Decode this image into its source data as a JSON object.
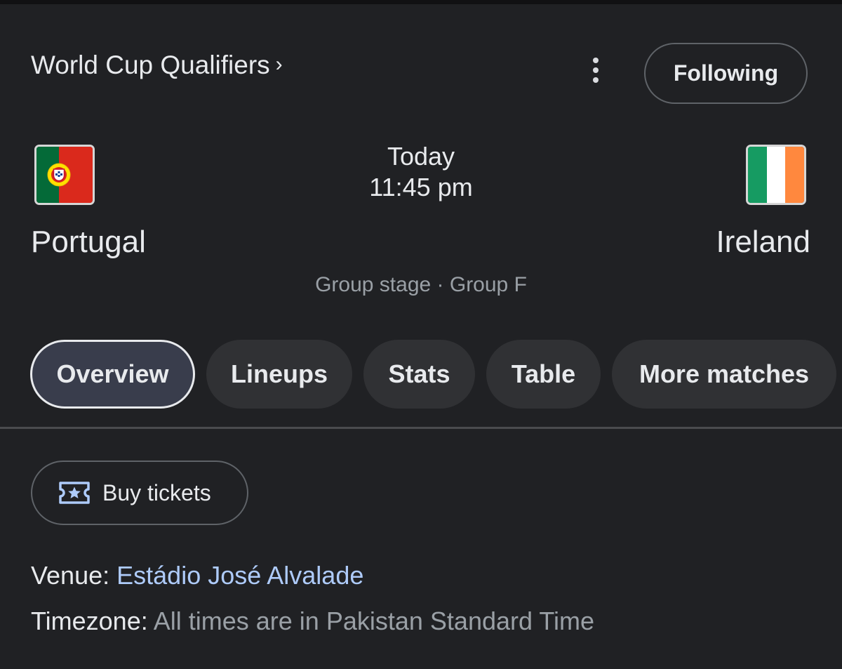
{
  "header": {
    "competition": "World Cup Qualifiers",
    "competition_chevron": "›",
    "menu_icon": "more-vert-icon",
    "follow_label": "Following"
  },
  "match": {
    "home": {
      "name": "Portugal",
      "flag": "portugal-flag-icon"
    },
    "away": {
      "name": "Ireland",
      "flag": "ireland-flag-icon"
    },
    "day": "Today",
    "time": "11:45 pm",
    "stage": "Group stage · Group F"
  },
  "tabs": [
    {
      "label": "Overview",
      "active": true
    },
    {
      "label": "Lineups",
      "active": false
    },
    {
      "label": "Stats",
      "active": false
    },
    {
      "label": "Table",
      "active": false
    },
    {
      "label": "More matches",
      "active": false
    }
  ],
  "tickets": {
    "label": "Buy tickets",
    "icon": "ticket-icon"
  },
  "info": {
    "venue_label": "Venue:",
    "venue_value": "Estádio José Alvalade",
    "timezone_label": "Timezone:",
    "timezone_value": "All times are in Pakistan Standard Time"
  },
  "colors": {
    "background": "#202124",
    "chip": "#303134",
    "chip_active": "#393d4c",
    "link": "#aecbfa",
    "muted": "#9aa0a6"
  }
}
